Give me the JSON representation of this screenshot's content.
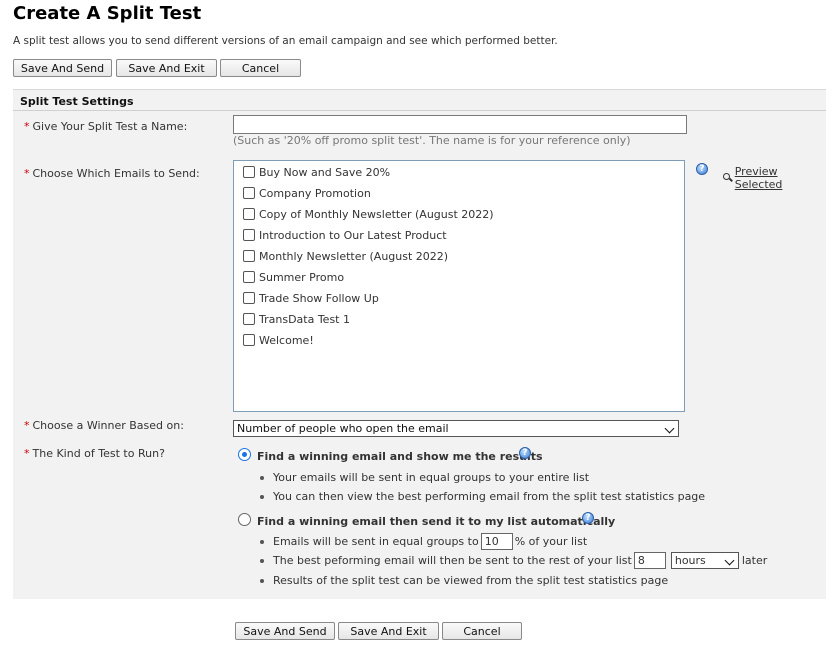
{
  "page": {
    "title": "Create A Split Test",
    "intro": "A split test allows you to send different versions of an email campaign and see which performed better."
  },
  "toolbar": {
    "save_and_send": "Save And Send",
    "save_and_exit": "Save And Exit",
    "cancel": "Cancel"
  },
  "settings": {
    "heading": "Split Test Settings",
    "required_mark": "*",
    "name_label": "Give Your Split Test a Name:",
    "name_value": "",
    "name_hint": "(Such as '20% off promo split test'. The name is for your reference only)",
    "emails_label": "Choose Which Emails to Send:",
    "emails": [
      {
        "label": "Buy Now and Save 20%",
        "checked": false
      },
      {
        "label": "Company Promotion",
        "checked": false
      },
      {
        "label": "Copy of Monthly Newsletter (August 2022)",
        "checked": false
      },
      {
        "label": "Introduction to Our Latest Product",
        "checked": false
      },
      {
        "label": "Monthly Newsletter (August 2022)",
        "checked": false
      },
      {
        "label": "Summer Promo",
        "checked": false
      },
      {
        "label": "Trade Show Follow Up",
        "checked": false
      },
      {
        "label": "TransData Test 1",
        "checked": false
      },
      {
        "label": "Welcome!",
        "checked": false
      }
    ],
    "preview_selected": "Preview Selected",
    "winner_label": "Choose a Winner Based on:",
    "winner_value": "Number of people who open the email",
    "kind_label": "The Kind of Test to Run?",
    "option_manual": {
      "title": "Find a winning email and show me the results",
      "selected": true,
      "bullets": [
        "Your emails will be sent in equal groups to your entire list",
        "You can then view the best performing email from the split test statistics page"
      ]
    },
    "option_auto": {
      "title": "Find a winning email then send it to my list automatically",
      "selected": false,
      "bullet1_prefix": "Emails will be sent in equal groups to",
      "percent_value": "10",
      "bullet1_suffix": "% of your list",
      "bullet2_prefix": "The best peforming email will then be sent to the rest of your list",
      "delay_value": "8",
      "delay_unit": "hours",
      "bullet2_suffix": "later",
      "bullet3": "Results of the split test can be viewed from the split test statistics page"
    }
  },
  "icons": {
    "help": "help-icon",
    "preview": "magnifier-icon"
  },
  "colors": {
    "panel_bg": "#f2f2f2",
    "required": "#cc0000",
    "radio_accent": "#1a73e8"
  }
}
